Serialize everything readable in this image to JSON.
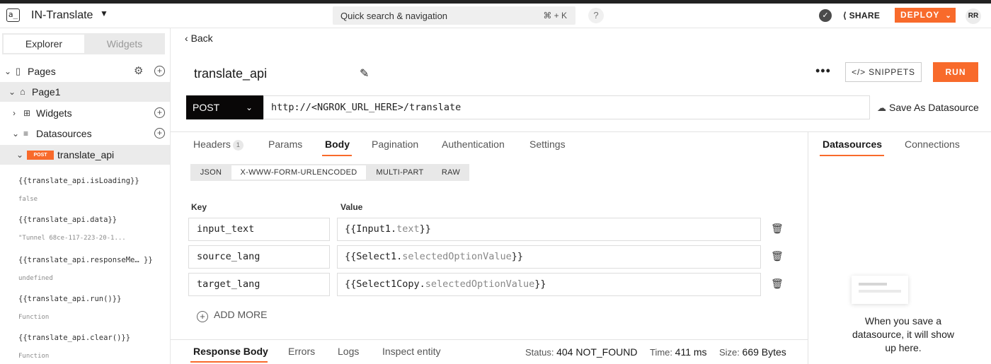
{
  "header": {
    "logo_text": "a_",
    "app_name": "IN-Translate",
    "search_placeholder": "Quick search & navigation",
    "search_shortcut": "⌘ + K",
    "help_label": "?",
    "share_label": "SHARE",
    "deploy_label": "DEPLOY",
    "avatar_initials": "RR"
  },
  "sidebar": {
    "tabs": [
      "Explorer",
      "Widgets"
    ],
    "active_tab": "Explorer",
    "tree": {
      "pages_label": "Pages",
      "page1_label": "Page1",
      "widgets_label": "Widgets",
      "datasources_label": "Datasources",
      "api_badge": "POST",
      "api_label": "translate_api"
    },
    "bindings": [
      {
        "expr": "{{translate_api.isLoading}}",
        "value": "false"
      },
      {
        "expr": "{{translate_api.data}}",
        "value": "\"Tunnel 68ce-117-223-20-1..."
      },
      {
        "expr": "{{translate_api.responseMe… }}",
        "value": "undefined"
      },
      {
        "expr": "{{translate_api.run()}}",
        "value": "Function"
      },
      {
        "expr": "{{translate_api.clear()}}",
        "value": "Function"
      }
    ]
  },
  "editor": {
    "back_label": "Back",
    "api_name": "translate_api",
    "snippets_label": "SNIPPETS",
    "run_label": "RUN",
    "method": "POST",
    "url": "http://<NGROK_URL_HERE>/translate",
    "save_as_datasource": "Save As Datasource",
    "tabs": [
      {
        "label": "Headers",
        "count": "1"
      },
      {
        "label": "Params"
      },
      {
        "label": "Body"
      },
      {
        "label": "Pagination"
      },
      {
        "label": "Authentication"
      },
      {
        "label": "Settings"
      }
    ],
    "active_tab": "Body",
    "body_types": [
      "JSON",
      "X-WWW-FORM-URLENCODED",
      "MULTI-PART",
      "RAW"
    ],
    "active_body_type": "X-WWW-FORM-URLENCODED",
    "key_header": "Key",
    "value_header": "Value",
    "params": [
      {
        "key": "input_text",
        "value_prefix": "{{Input1.",
        "value_prop": "text",
        "value_suffix": "}}"
      },
      {
        "key": "source_lang",
        "value_prefix": "{{Select1.",
        "value_prop": "selectedOptionValue",
        "value_suffix": "}}"
      },
      {
        "key": "target_lang",
        "value_prefix": "{{Select1Copy.",
        "value_prop": "selectedOptionValue",
        "value_suffix": "}}"
      }
    ],
    "add_more_label": "ADD MORE"
  },
  "response": {
    "tabs": [
      "Response Body",
      "Errors",
      "Logs",
      "Inspect entity"
    ],
    "active_tab": "Response Body",
    "status_label": "Status:",
    "status_value": "404 NOT_FOUND",
    "time_label": "Time:",
    "time_value": "411 ms",
    "size_label": "Size:",
    "size_value": "669 Bytes"
  },
  "right_panel": {
    "tabs": [
      "Datasources",
      "Connections"
    ],
    "active_tab": "Datasources",
    "empty_text": "When you save a datasource, it will show up here."
  },
  "colors": {
    "accent": "#f86a2b",
    "method_bg": "#090707"
  }
}
